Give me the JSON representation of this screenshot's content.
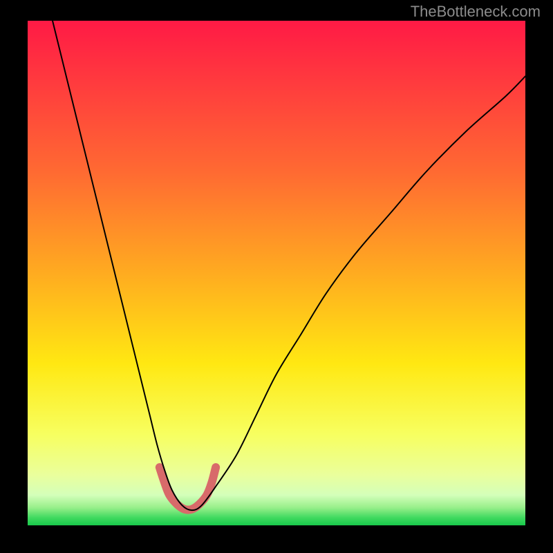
{
  "watermark": "TheBottleneck.com",
  "chart_data": {
    "type": "line",
    "title": "",
    "xlabel": "",
    "ylabel": "",
    "xlim": [
      0,
      100
    ],
    "ylim": [
      0,
      100
    ],
    "background_gradient": {
      "stops": [
        {
          "t": 0.0,
          "color": "#ff1a45"
        },
        {
          "t": 0.12,
          "color": "#ff3a3e"
        },
        {
          "t": 0.3,
          "color": "#ff6a32"
        },
        {
          "t": 0.5,
          "color": "#ffab20"
        },
        {
          "t": 0.68,
          "color": "#ffe812"
        },
        {
          "t": 0.82,
          "color": "#f7ff60"
        },
        {
          "t": 0.9,
          "color": "#eaff9c"
        },
        {
          "t": 0.94,
          "color": "#d4ffba"
        },
        {
          "t": 0.965,
          "color": "#97ef8a"
        },
        {
          "t": 0.985,
          "color": "#3fd95f"
        },
        {
          "t": 1.0,
          "color": "#18c94b"
        }
      ]
    },
    "series": [
      {
        "name": "bottleneck-curve",
        "color": "#000000",
        "width": 2,
        "x": [
          5,
          7,
          9,
          11,
          13,
          15,
          17,
          19,
          21,
          23,
          24.5,
          26,
          27.5,
          29,
          31,
          33,
          35,
          38,
          42,
          46,
          50,
          55,
          60,
          66,
          73,
          80,
          88,
          96,
          100
        ],
        "y": [
          100,
          92,
          84,
          76,
          68,
          60,
          52,
          44,
          36,
          28,
          22,
          16,
          11,
          7,
          4,
          3,
          4,
          8,
          14,
          22,
          30,
          38,
          46,
          54,
          62,
          70,
          78,
          85,
          89
        ]
      },
      {
        "name": "optimal-marker",
        "color": "#d86a6a",
        "width": 12,
        "linecap": "round",
        "x": [
          26.5,
          27.5,
          28.5,
          30,
          31.5,
          33,
          34.5,
          36,
          37,
          37.8
        ],
        "y": [
          11.5,
          8.5,
          6,
          4.2,
          3.2,
          3.2,
          4.2,
          6,
          8.5,
          11.5
        ]
      }
    ]
  }
}
